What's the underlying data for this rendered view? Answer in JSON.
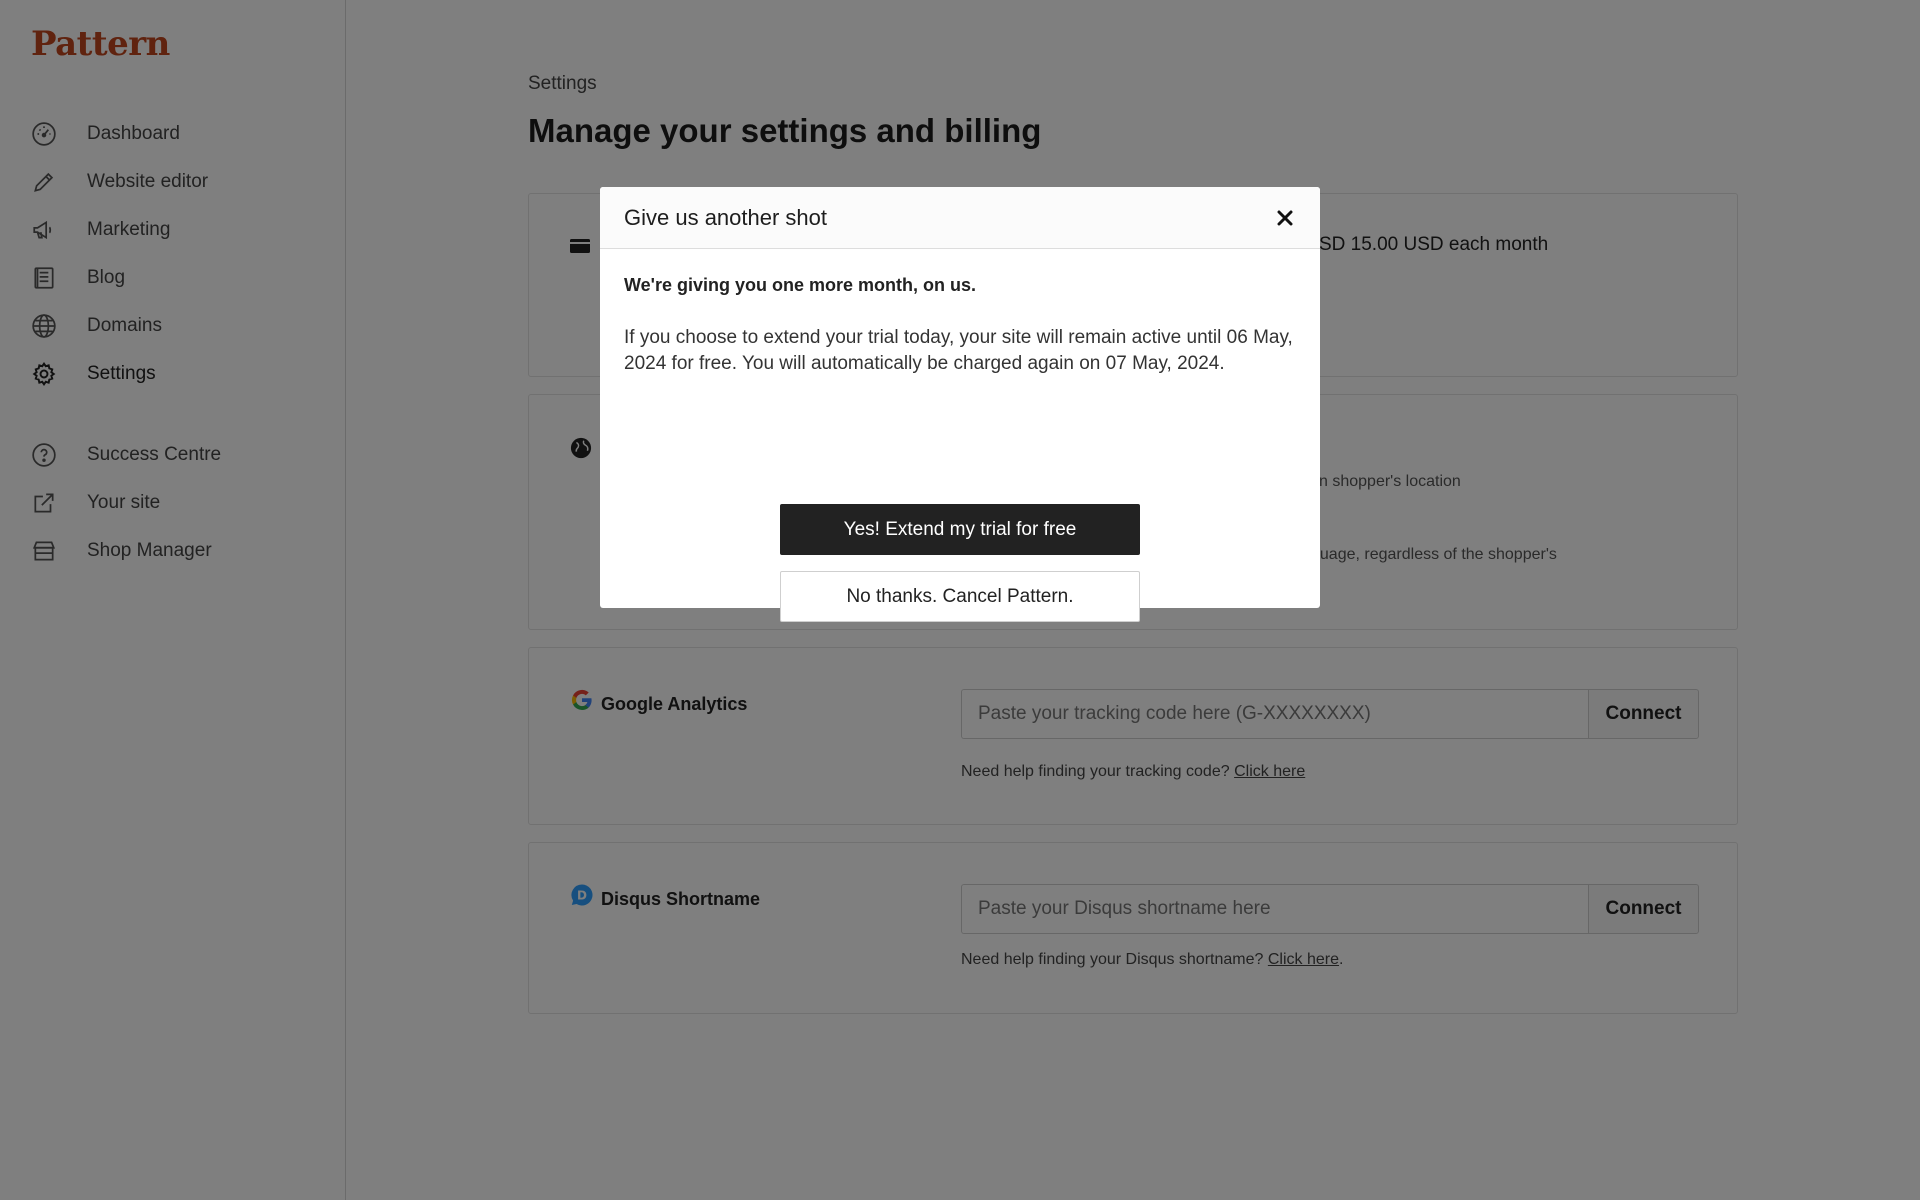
{
  "app": {
    "logo_text": "Pattern",
    "brand_color": "#c0471f"
  },
  "sidebar": {
    "items": [
      {
        "label": "Dashboard",
        "icon": "dashboard-gauge-icon"
      },
      {
        "label": "Website editor",
        "icon": "pencil-icon"
      },
      {
        "label": "Marketing",
        "icon": "megaphone-icon"
      },
      {
        "label": "Blog",
        "icon": "blog-list-icon"
      },
      {
        "label": "Domains",
        "icon": "globe-icon"
      },
      {
        "label": "Settings",
        "icon": "gear-icon",
        "active": true
      }
    ],
    "secondary_items": [
      {
        "label": "Success Centre",
        "icon": "help-circle-icon"
      },
      {
        "label": "Your site",
        "icon": "external-link-icon"
      },
      {
        "label": "Shop Manager",
        "icon": "storefront-icon"
      }
    ]
  },
  "main": {
    "breadcrumb": "Settings",
    "title": "Manage your settings and billing",
    "billing": {
      "icon": "credit-card-icon",
      "partial_text": "SD 15.00 USD each month"
    },
    "language": {
      "icon": "globe-icon",
      "partial_text_1": "n shopper's location",
      "partial_text_2": "guage, regardless of the shopper's"
    },
    "google_analytics": {
      "icon": "google-g-icon",
      "label": "Google Analytics",
      "placeholder": "Paste your tracking code here (G-XXXXXXXX)",
      "button": "Connect",
      "help_prefix": "Need help finding your tracking code?",
      "help_link": "Click here"
    },
    "disqus": {
      "icon": "disqus-icon",
      "label": "Disqus Shortname",
      "placeholder": "Paste your Disqus shortname here",
      "button": "Connect",
      "help_prefix": "Need help finding your Disqus shortname?",
      "help_link": "Click here",
      "help_suffix": "."
    }
  },
  "modal": {
    "title": "Give us another shot",
    "lead": "We're giving you one more month, on us.",
    "body": "If you choose to extend your trial today, your site will remain active until 06 May, 2024 for free. You will automatically be charged again on 07 May, 2024.",
    "primary_button": "Yes! Extend my trial for free",
    "secondary_button": "No thanks. Cancel Pattern.",
    "close_icon": "close-icon"
  }
}
